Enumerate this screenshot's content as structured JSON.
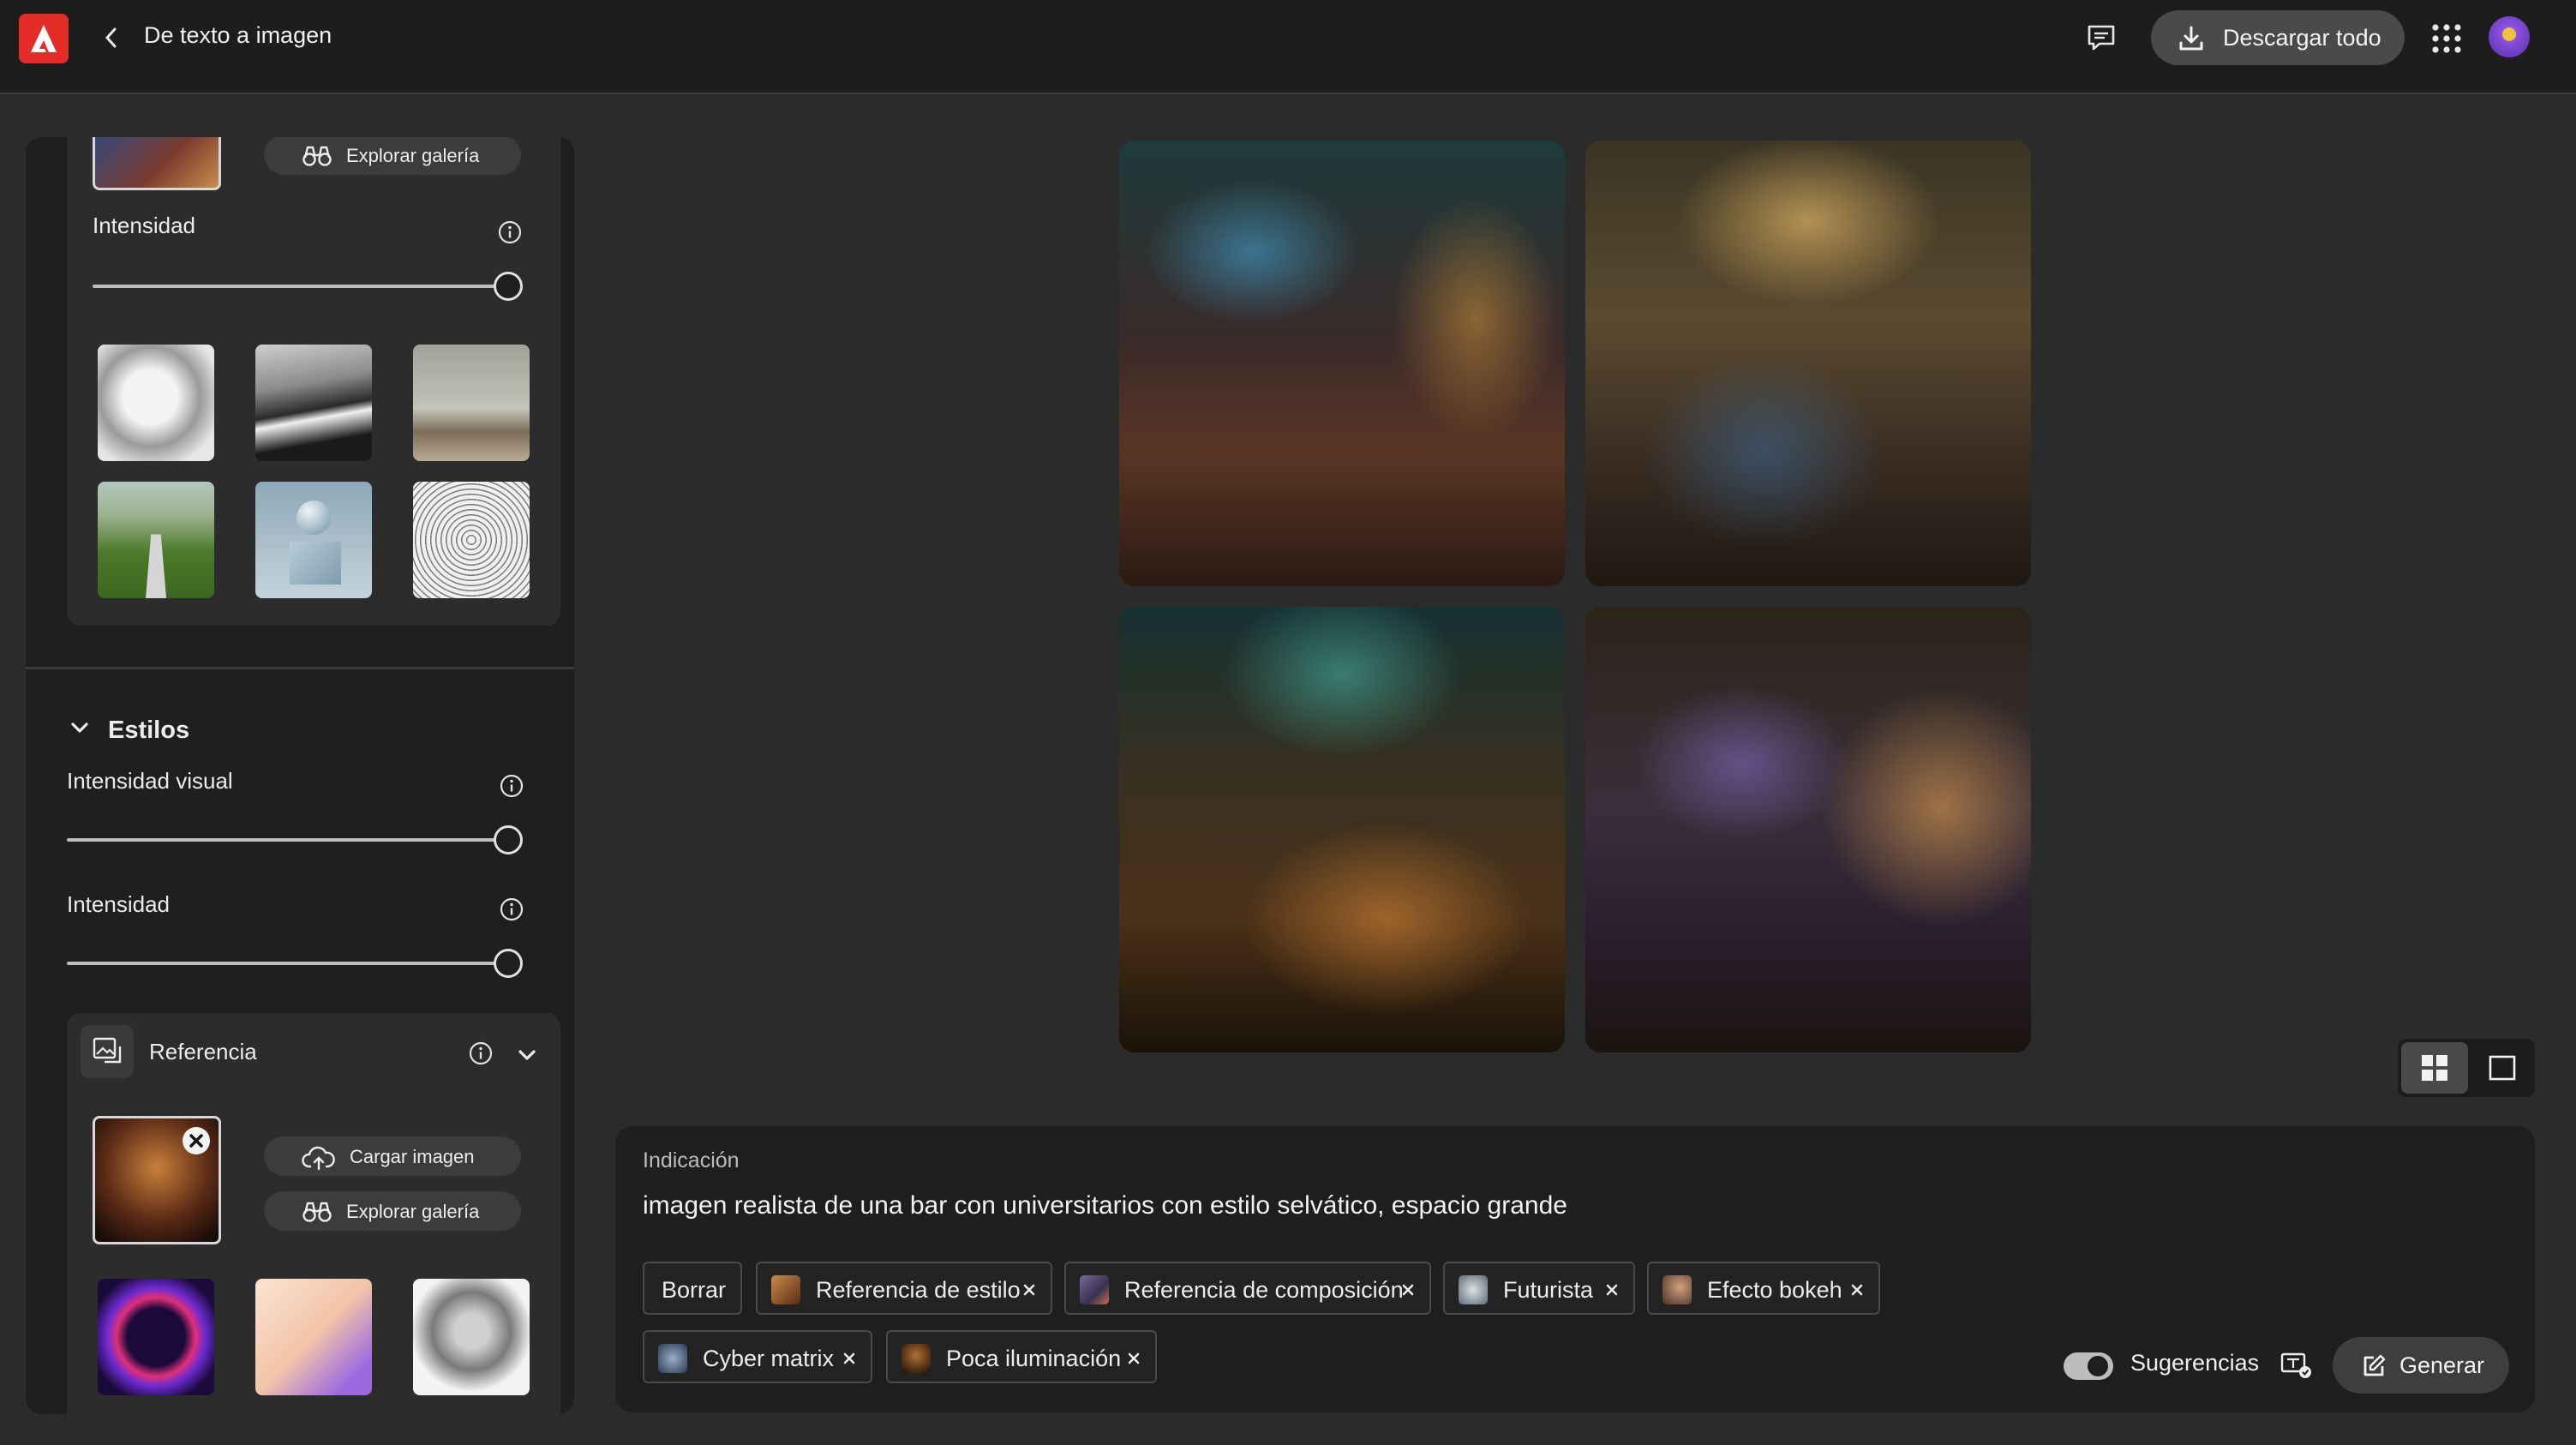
{
  "app": {
    "title": "De texto a imagen",
    "download_all": "Descargar todo",
    "brand_color": "#e52d27"
  },
  "left_panel": {
    "top_section": {
      "explore_gallery": "Explorar galería",
      "intensity_label": "Intensidad",
      "intensity_value": 1.0,
      "style_thumbnails": [
        "bird-sketch",
        "bw-landscape",
        "modern-interior",
        "green-road",
        "3d-sphere",
        "owl-sketch"
      ]
    },
    "estilos": {
      "heading": "Estilos",
      "visual_intensity_label": "Intensidad visual",
      "visual_intensity_value": 1.0,
      "intensity_label": "Intensidad",
      "intensity_value": 1.0
    },
    "referencia": {
      "heading": "Referencia",
      "upload_image": "Cargar imagen",
      "explore_gallery": "Explorar galería",
      "thumbnails": [
        "neon-astronaut",
        "thumbs-up-3d",
        "classical-portrait"
      ]
    }
  },
  "gallery": {
    "images": [
      "bar-scene-1",
      "bar-scene-2",
      "bar-scene-3",
      "bar-scene-4"
    ],
    "view_mode": "grid"
  },
  "prompt": {
    "label": "Indicación",
    "text": "imagen realista de una bar con universitarios con estilo selvático, espacio grande",
    "clear_label": "Borrar",
    "chips": [
      {
        "label": "Referencia de estilo"
      },
      {
        "label": "Referencia de composición"
      },
      {
        "label": "Futurista"
      },
      {
        "label": "Efecto bokeh"
      },
      {
        "label": "Cyber matrix"
      },
      {
        "label": "Poca iluminación"
      }
    ],
    "suggestions_label": "Sugerencias",
    "suggestions_on": true,
    "generate_label": "Generar"
  }
}
